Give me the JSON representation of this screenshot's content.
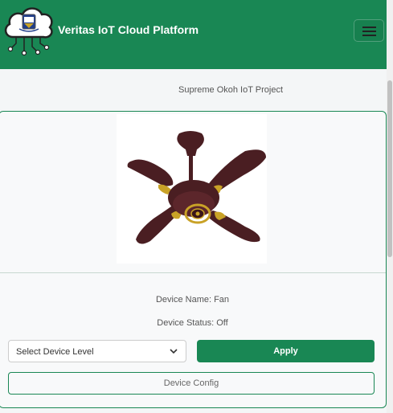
{
  "navbar": {
    "brand_title": "Veritas IoT Cloud Platform",
    "menu_icon": "hamburger-menu-icon",
    "logo_icon": "cloud-circuit-crest-logo"
  },
  "page": {
    "project_title": "Supreme Okoh IoT Project"
  },
  "device": {
    "image_icon": "ceiling-fan-image",
    "name_line": "Device Name: Fan",
    "status_line": "Device Status: Off"
  },
  "controls": {
    "level_select": {
      "selected": "Select Device Level"
    },
    "apply_label": "Apply",
    "config_label": "Device Config"
  },
  "colors": {
    "brand": "#198754",
    "background": "#f4f6f7",
    "fan_brown": "#4a1e22",
    "fan_gold": "#c9a227"
  }
}
